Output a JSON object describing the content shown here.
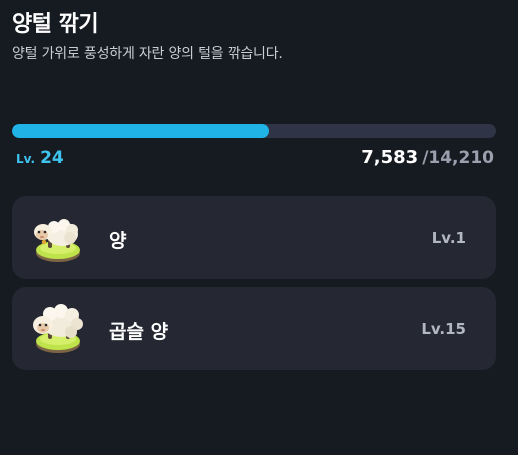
{
  "header": {
    "title": "양털 깎기",
    "subtitle": "양털 가위로 풍성하게 자란 양의 털을 깎습니다."
  },
  "progress": {
    "fraction": 0.53,
    "fill_color": "#1fb3e6",
    "level_prefix": "Lv.",
    "level_value": "24",
    "xp_current": "7,583",
    "xp_max": "/14,210"
  },
  "sheep_list": [
    {
      "name": "양",
      "level": "Lv.1",
      "icon": "sheep-icon"
    },
    {
      "name": "곱슬 양",
      "level": "Lv.15",
      "icon": "curly-sheep-icon"
    }
  ]
}
